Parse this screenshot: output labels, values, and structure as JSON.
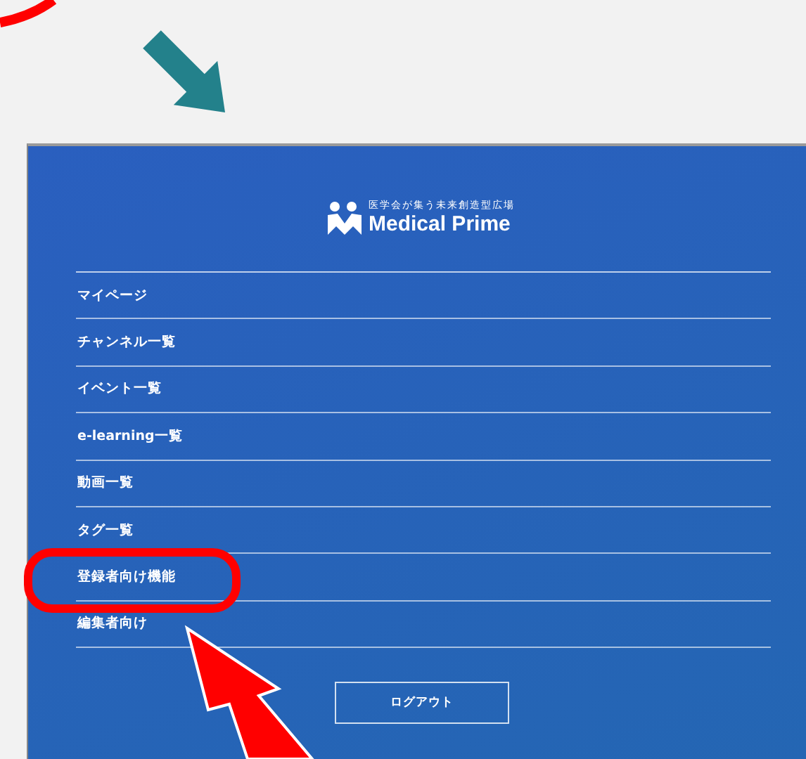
{
  "logo": {
    "tagline": "医学会が集う未来創造型広場",
    "name": "Medical Prime"
  },
  "menu": [
    {
      "label": "マイページ",
      "circled": false
    },
    {
      "label": "チャンネル一覧",
      "circled": false
    },
    {
      "label": "イベント一覧",
      "circled": false
    },
    {
      "label": "e-learning一覧",
      "circled": false
    },
    {
      "label": "動画一覧",
      "circled": false
    },
    {
      "label": "タグ一覧",
      "circled": false
    },
    {
      "label": "登録者向け機能",
      "circled": true
    },
    {
      "label": "編集者向け",
      "circled": false
    }
  ],
  "logout": "ログアウト"
}
